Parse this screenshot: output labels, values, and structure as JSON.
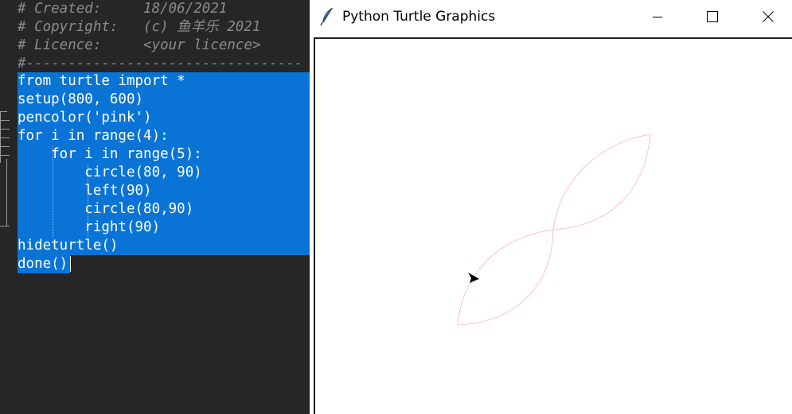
{
  "editor": {
    "comment_lines": [
      "# Created:     18/06/2021",
      "# Copyright:   (c) 鱼羊乐 2021",
      "# Licence:     <your licence>",
      "#---------------------------------"
    ],
    "code_lines": [
      "from turtle import *",
      "setup(800, 600)",
      "pencolor('pink')",
      "for i in range(4):",
      "    for i in range(5):",
      "        circle(80, 90)",
      "        left(90)",
      "        circle(80,90)",
      "        right(90)",
      "hideturtle()",
      "done()"
    ],
    "selection_color": "#0a74d6"
  },
  "turtle_window": {
    "title": "Python Turtle Graphics",
    "icon": "feather-icon",
    "controls": [
      "minimize-icon",
      "maximize-icon",
      "close-icon"
    ],
    "pen_color": "pink"
  }
}
